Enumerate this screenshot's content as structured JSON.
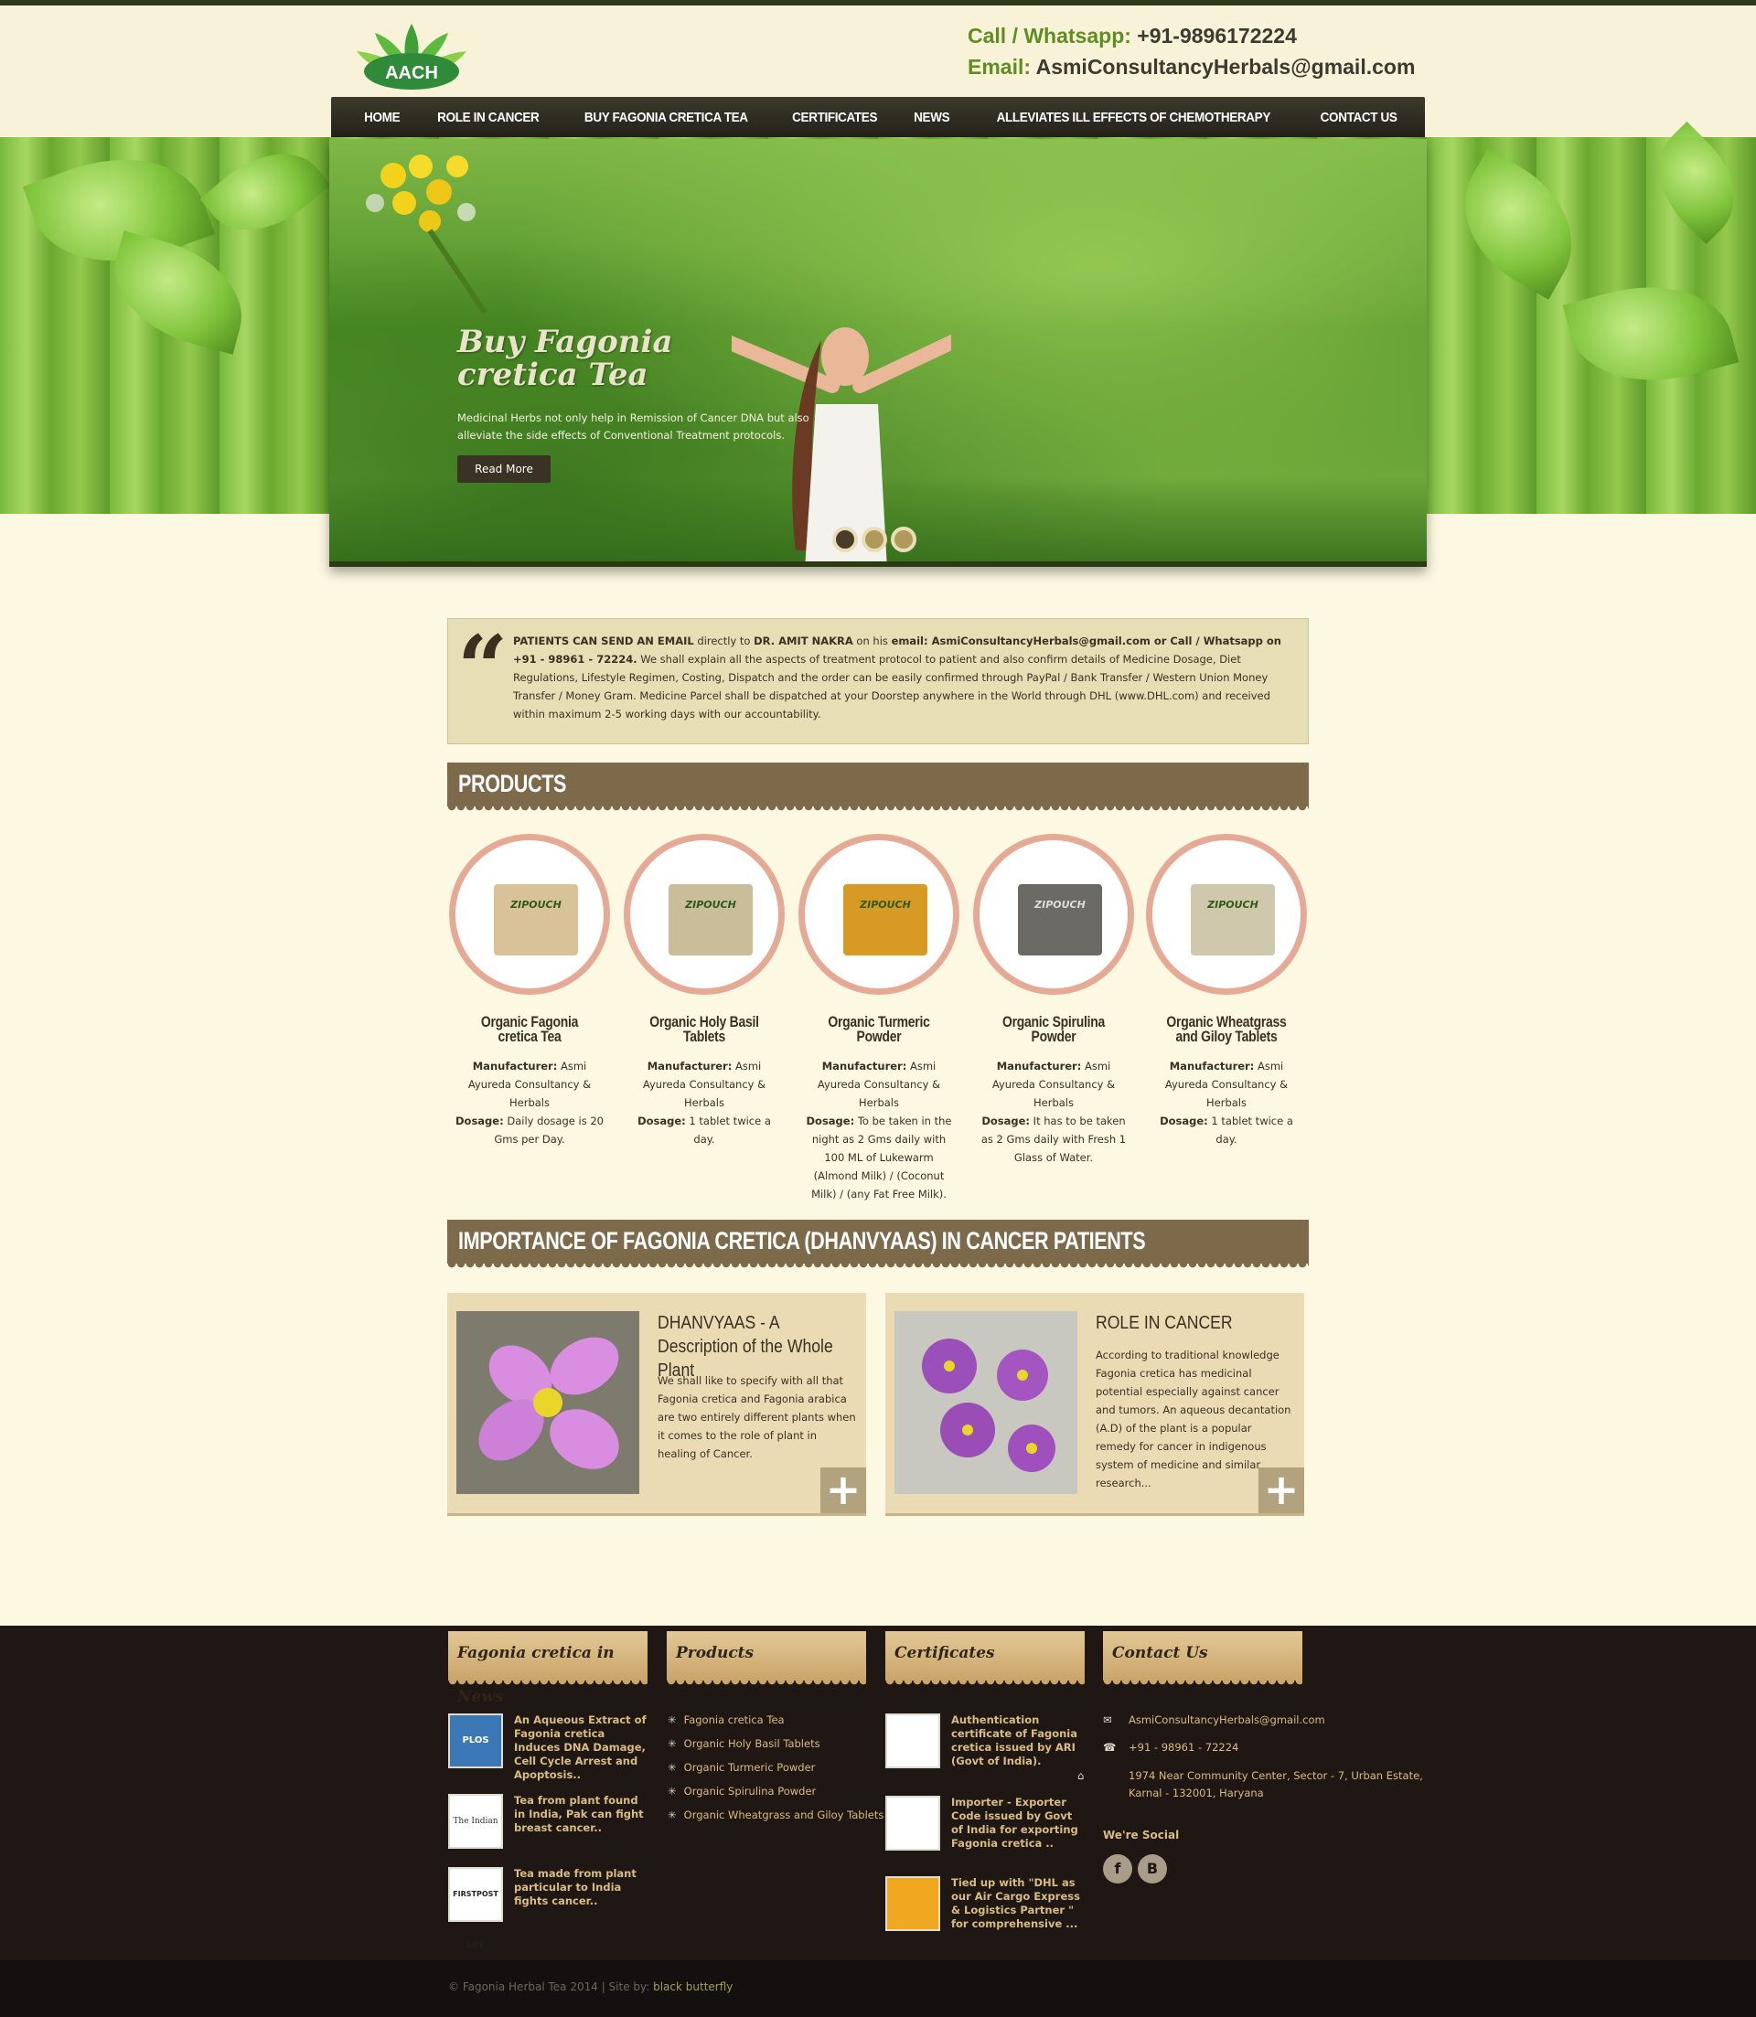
{
  "header": {
    "logo_text": "AACH",
    "phone_label": "Call / Whatsapp:",
    "phone_value": "+91-9896172224",
    "email_label": "Email:",
    "email_value": "AsmiConsultancyHerbals@gmail.com"
  },
  "nav": {
    "items": [
      "HOME",
      "ROLE IN CANCER",
      "BUY FAGONIA CRETICA TEA",
      "CERTIFICATES",
      "NEWS",
      "ALLEVIATES ILL EFFECTS OF CHEMOTHERAPY",
      "CONTACT US"
    ]
  },
  "slider": {
    "title": "Buy Fagonia cretica Tea",
    "text": "Medicinal Herbs not only help in Remission of Cancer DNA but also alleviate the side effects of Conventional Treatment protocols.",
    "button": "Read More"
  },
  "quote": {
    "p1": "PATIENTS CAN SEND AN EMAIL",
    "p2": " directly to ",
    "p3": "DR. AMIT NAKRA",
    "p4": " on his ",
    "p5": "email: AsmiConsultancyHerbals@gmail.com or Call / Whatsapp on +91 - 98961 - 72224.",
    "p6": " We shall explain all the aspects of treatment protocol to patient and also confirm details of Medicine Dosage, Diet Regulations, Lifestyle Regimen, Costing, Dispatch and the order can be easily confirmed through PayPal / Bank Transfer / Western Union Money Transfer / Money Gram. Medicine Parcel shall be dispatched at your Doorstep anywhere in the World through DHL (www.DHL.com) and received within maximum 2-5 working days with our accountability."
  },
  "products": {
    "heading": "PRODUCTS",
    "pouch_label": "ZIPOUCH",
    "manufacturer_label": "Manufacturer:",
    "dosage_label": "Dosage:",
    "items": [
      {
        "name": "Organic Fagonia cretica Tea",
        "manufacturer": " Asmi Ayureda Consultancy & Herbals",
        "dosage": " Daily dosage is 20 Gms per Day."
      },
      {
        "name": "Organic Holy Basil Tablets",
        "manufacturer": " Asmi Ayureda Consultancy & Herbals",
        "dosage": " 1 tablet twice a day."
      },
      {
        "name": "Organic Turmeric Powder",
        "manufacturer": " Asmi Ayureda Consultancy & Herbals",
        "dosage": " To be taken in the night as 2 Gms daily with 100 ML of Lukewarm (Almond Milk) / (Coconut Milk) / (any Fat Free Milk)."
      },
      {
        "name": "Organic Spirulina Powder",
        "manufacturer": " Asmi Ayureda Consultancy & Herbals",
        "dosage": " It has to be taken as 2 Gms daily with Fresh 1 Glass of Water."
      },
      {
        "name": "Organic Wheatgrass and Giloy Tablets",
        "manufacturer": " Asmi Ayureda Consultancy & Herbals",
        "dosage": " 1 tablet twice a day."
      }
    ]
  },
  "importance": {
    "heading": "IMPORTANCE OF FAGONIA CRETICA (DHANVYAAS) IN CANCER PATIENTS",
    "cards": [
      {
        "title": "DHANVYAAS - A Description of the Whole Plant",
        "text": "We shall like to specify with all that Fagonia cretica and Fagonia arabica are two entirely different plants when it comes to the role of plant in healing of Cancer."
      },
      {
        "title": "ROLE IN CANCER",
        "text": "According to traditional knowledge Fagonia cretica has medicinal potential especially against cancer and tumors. An aqueous decantation (A.D) of the plant is a popular remedy for cancer in indigenous system of medicine and similar research..."
      }
    ]
  },
  "footer": {
    "news_heading": "Fagonia cretica in News",
    "products_heading": "Products",
    "certificates_heading": "Certificates",
    "contact_heading": "Contact Us",
    "news": [
      {
        "thumb": "PLOS",
        "text": "An Aqueous Extract of Fagonia cretica Induces DNA Damage, Cell Cycle Arrest and Apoptosis.."
      },
      {
        "thumb": "The Indian EX",
        "text": "Tea from plant found in India, Pak can fight breast cancer.."
      },
      {
        "thumb": "FIRSTPOST LIFE",
        "text": "Tea made from plant particular to India fights cancer.."
      }
    ],
    "products": [
      "Fagonia cretica Tea",
      "Organic Holy Basil Tablets",
      "Organic Turmeric Powder",
      "Organic Spirulina Powder",
      "Organic Wheatgrass and Giloy Tablets"
    ],
    "certificates": [
      {
        "text": "Authentication certificate of Fagonia cretica issued by ARI (Govt of India)."
      },
      {
        "text": "Importer - Exporter Code issued by Govt of India for exporting Fagonia cretica .."
      },
      {
        "text": "Tied up with \"DHL as our Air Cargo Express & Logistics Partner \" for comprehensive ..."
      }
    ],
    "contact": {
      "email": "AsmiConsultancyHerbals@gmail.com",
      "phone": "+91 - 98961 - 72224",
      "address": "1974 Near Community Center, Sector - 7, Urban Estate, Karnal - 132001, Haryana"
    },
    "social_heading": "We're Social",
    "copyright": "© Fagonia Herbal Tea 2014 | Site by: ",
    "site_by": "black butterfly"
  },
  "colors": {
    "nav_bg": "#2e2c22",
    "section_head": "#7c6a4a",
    "circle_border": "#e5aa96",
    "footer_bg": "#1e1713",
    "accent_green": "#5f8d22"
  }
}
